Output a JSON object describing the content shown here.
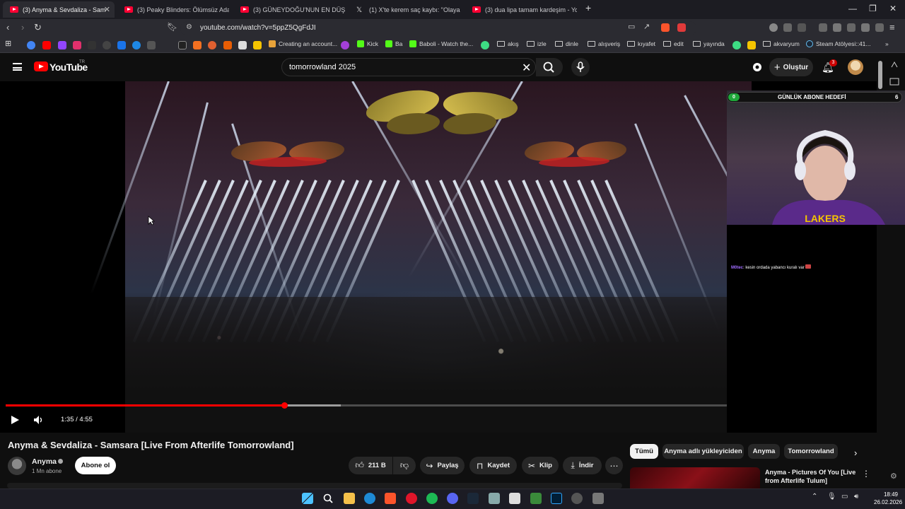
{
  "browser": {
    "tabs": [
      {
        "title": "(3) Anyma & Sevdaliza - Sam",
        "active": true,
        "icon": "youtube-icon"
      },
      {
        "title": "(3) Peaky Blinders: Ölümsüz Adam | ",
        "active": false,
        "icon": "youtube-icon"
      },
      {
        "title": "(3) GÜNEYDOĞU'NUN EN DÜŞÜK PU",
        "active": false,
        "icon": "youtube-icon"
      },
      {
        "title": "(1) X'te kerem saç kaybı: \"Olaya bak",
        "active": false,
        "icon": "x-icon"
      },
      {
        "title": "(3) dua lipa tamam kardeşim - YouTu",
        "active": false,
        "icon": "youtube-icon"
      }
    ],
    "url": "youtube.com/watch?v=5ppZ5QgFdJI",
    "bookmarks": [
      {
        "label": "Creating an account...",
        "type": "link"
      },
      {
        "label": "Kick",
        "type": "link"
      },
      {
        "label": "Ba",
        "type": "link"
      },
      {
        "label": "Baboli - Watch the...",
        "type": "link"
      },
      {
        "label": "akış",
        "type": "folder"
      },
      {
        "label": "izle",
        "type": "folder"
      },
      {
        "label": "dinle",
        "type": "folder"
      },
      {
        "label": "alışveriş",
        "type": "folder"
      },
      {
        "label": "kıyafet",
        "type": "folder"
      },
      {
        "label": "edit",
        "type": "folder"
      },
      {
        "label": "yayında",
        "type": "folder"
      },
      {
        "label": "akvaryum",
        "type": "folder"
      },
      {
        "label": "Steam Atölyesi::41...",
        "type": "link"
      }
    ]
  },
  "youtube": {
    "logo_text": "YouTube",
    "region": "TR",
    "search_query": "tomorrowland 2025",
    "create_label": "Oluştur",
    "notifications": "3"
  },
  "player": {
    "current_time": "1:35",
    "duration": "4:55",
    "time_display": "1:35 / 4:55",
    "played_fraction": 0.322,
    "buffered_fraction": 0.387
  },
  "stream_overlay": {
    "goal_label": "GÜNLÜK ABONE HEDEFİ",
    "goal_start": "0",
    "goal_end": "6",
    "chat_user": "M0tec",
    "chat_message": ": kesin ordada yabancı kuralı var"
  },
  "video": {
    "title": "Anyma & Sevdaliza - Samsara [Live From Afterlife Tomorrowland]",
    "channel": "Anyma",
    "subscribers": "1 Mn abone",
    "subscribe_label": "Abone ol",
    "likes": "211 B",
    "share_label": "Paylaş",
    "save_label": "Kaydet",
    "clip_label": "Klip",
    "download_label": "İndir"
  },
  "chips": [
    "Tümü",
    "Anyma adlı yükleyiciden",
    "Anyma",
    "Tomorrowland"
  ],
  "recommendation": {
    "title": "Anyma - Pictures Of You [Live from Afterlife Tulum]"
  },
  "taskbar": {
    "time": "18:49",
    "date": "26.02.2026"
  },
  "colors": {
    "youtube_red": "#ff0000",
    "background": "#0f0f0f",
    "goal_green": "#1fa83a"
  }
}
